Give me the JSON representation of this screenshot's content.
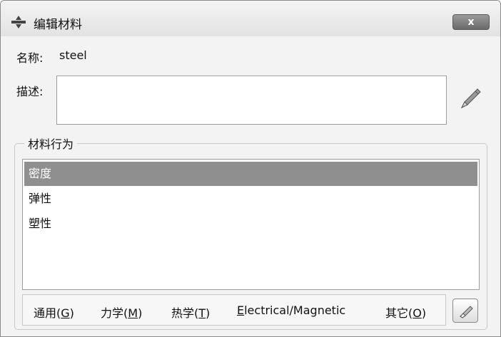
{
  "window": {
    "title": "编辑材料",
    "close_label": "x"
  },
  "name": {
    "label": "名称:",
    "value": "steel"
  },
  "description": {
    "label": "描述:",
    "value": ""
  },
  "behaviors": {
    "group_title": "材料行为",
    "items": [
      {
        "label": "密度",
        "selected": true
      },
      {
        "label": "弹性",
        "selected": false
      },
      {
        "label": "塑性",
        "selected": false
      }
    ]
  },
  "menu": {
    "items": [
      {
        "pre": "通用(",
        "key": "G",
        "post": ")"
      },
      {
        "pre": "力学(",
        "key": "M",
        "post": ")"
      },
      {
        "pre": "热学(",
        "key": "T",
        "post": ")"
      },
      {
        "pre": "",
        "key": "E",
        "post": "lectrical/Magnetic"
      },
      {
        "pre": "其它(",
        "key": "O",
        "post": ")"
      }
    ]
  },
  "icons": {
    "app": "material-icon",
    "description_edit": "pencil-icon",
    "behavior_edit": "eraser-icon"
  }
}
